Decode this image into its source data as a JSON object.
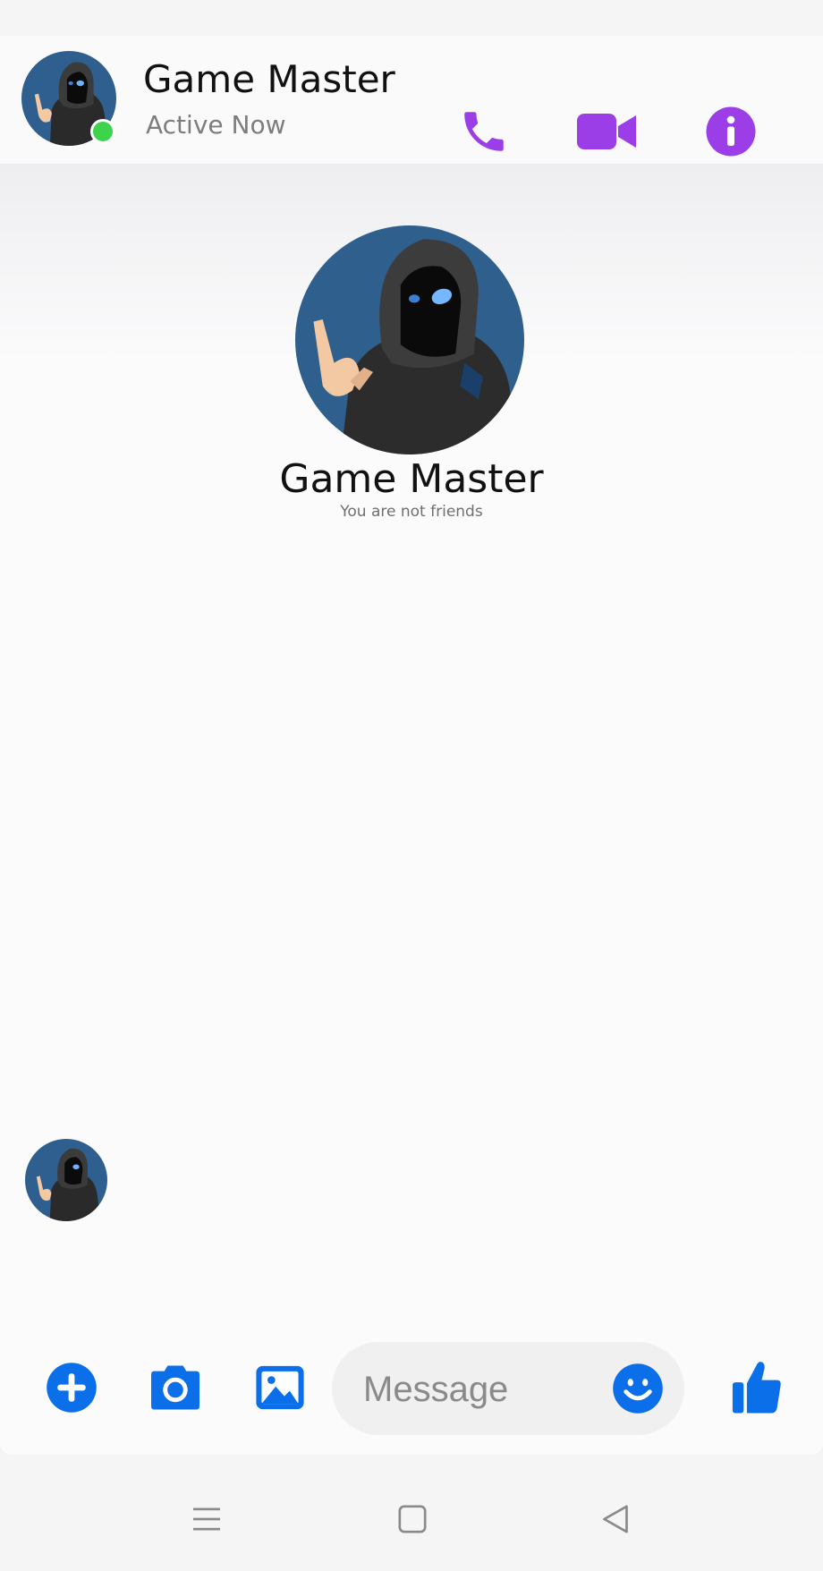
{
  "header": {
    "contact_name": "Game Master",
    "status": "Active Now",
    "icons": [
      "phone-icon",
      "video-icon",
      "info-icon"
    ],
    "accent_color": "#9b3ee8",
    "online_color": "#3dd34a"
  },
  "profile": {
    "name": "Game Master",
    "relationship": "You are not friends"
  },
  "composer": {
    "placeholder": "Message",
    "icons": [
      "plus-icon",
      "camera-icon",
      "gallery-icon",
      "emoji-icon",
      "thumbs-up-icon"
    ],
    "accent_color": "#0a6fe8"
  },
  "system_nav": {
    "icons": [
      "menu-icon",
      "home-icon",
      "back-icon"
    ]
  }
}
